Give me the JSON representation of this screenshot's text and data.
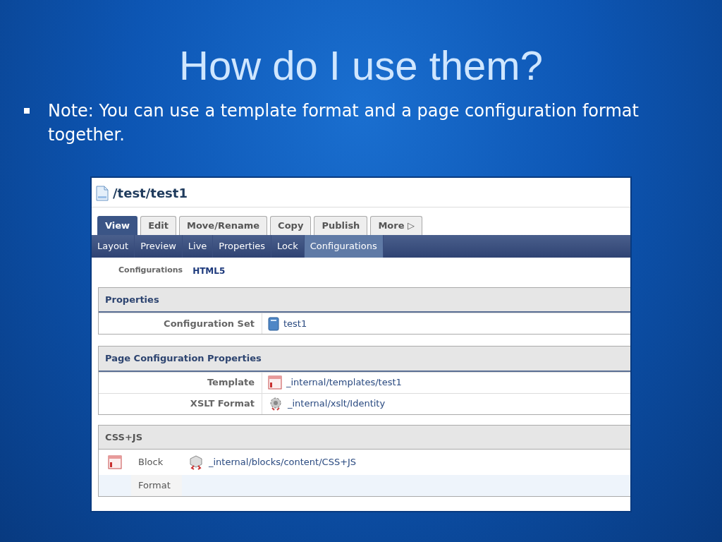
{
  "slide": {
    "title": "How do I use them?",
    "bullets": [
      "Note: You can use a template format and a page configuration format together."
    ]
  },
  "screenshot": {
    "path": "/test/test1",
    "tabs": [
      {
        "label": "View",
        "selected": true
      },
      {
        "label": "Edit",
        "selected": false
      },
      {
        "label": "Move/Rename",
        "selected": false
      },
      {
        "label": "Copy",
        "selected": false
      },
      {
        "label": "Publish",
        "selected": false
      },
      {
        "label": "More ▷",
        "selected": false
      }
    ],
    "subtabs": [
      {
        "label": "Layout",
        "selected": false
      },
      {
        "label": "Preview",
        "selected": false
      },
      {
        "label": "Live",
        "selected": false
      },
      {
        "label": "Properties",
        "selected": false
      },
      {
        "label": "Lock",
        "selected": false
      },
      {
        "label": "Configurations",
        "selected": true
      }
    ],
    "configurations": {
      "label": "Configurations",
      "value": "HTML5"
    },
    "panels": [
      {
        "title": "Properties",
        "rows": [
          {
            "label": "Configuration Set",
            "kind": "set",
            "value": "test1"
          }
        ]
      },
      {
        "title": "Page Configuration Properties",
        "rows": [
          {
            "label": "Template",
            "kind": "template",
            "value": "_internal/templates/test1"
          },
          {
            "label": "XSLT Format",
            "kind": "format",
            "value": "_internal/xslt/Identity"
          }
        ]
      }
    ],
    "region": {
      "title": "CSS+JS",
      "rows": [
        {
          "label": "Block",
          "kind": "block",
          "value": "_internal/blocks/content/CSS+JS"
        },
        {
          "label": "Format",
          "kind": "empty"
        }
      ]
    }
  }
}
